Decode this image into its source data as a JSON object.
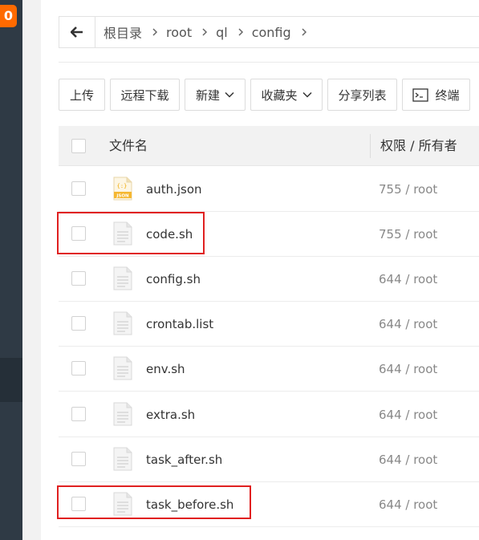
{
  "sidebar": {
    "badge": "0"
  },
  "breadcrumb": {
    "items": [
      "根目录",
      "root",
      "ql",
      "config"
    ]
  },
  "toolbar": {
    "upload": "上传",
    "remote_download": "远程下载",
    "new": "新建",
    "favorites": "收藏夹",
    "share_list": "分享列表",
    "terminal": "终端"
  },
  "table": {
    "header_name": "文件名",
    "header_perm": "权限 / 所有者",
    "rows": [
      {
        "name": "auth.json",
        "perm": "755 / root",
        "icon": "json-file-icon"
      },
      {
        "name": "code.sh",
        "perm": "755 / root",
        "icon": "file-icon"
      },
      {
        "name": "config.sh",
        "perm": "644 / root",
        "icon": "file-icon"
      },
      {
        "name": "crontab.list",
        "perm": "644 / root",
        "icon": "file-icon"
      },
      {
        "name": "env.sh",
        "perm": "644 / root",
        "icon": "file-icon"
      },
      {
        "name": "extra.sh",
        "perm": "644 / root",
        "icon": "file-icon"
      },
      {
        "name": "task_after.sh",
        "perm": "644 / root",
        "icon": "file-icon"
      },
      {
        "name": "task_before.sh",
        "perm": "644 / root",
        "icon": "file-icon"
      }
    ]
  },
  "colors": {
    "badge": "#ff6a00",
    "sidebar": "#2f3a45",
    "highlight": "#e02020",
    "json_icon": "#f5b731"
  }
}
